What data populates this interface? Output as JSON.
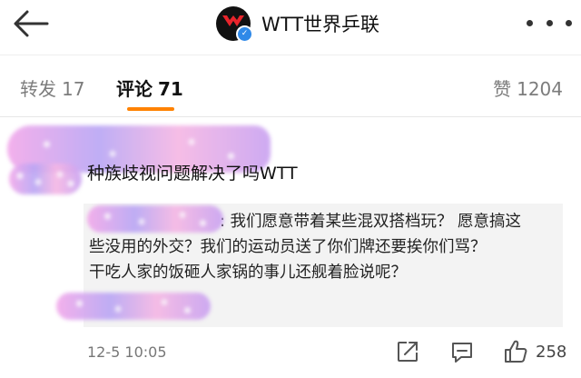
{
  "header": {
    "account_name": "WTT世界乒联"
  },
  "tabs": {
    "repost": {
      "label": "转发",
      "count": "17"
    },
    "comments": {
      "label": "评论",
      "count": "71"
    },
    "likes": {
      "label": "赞",
      "count": "1204"
    }
  },
  "comment": {
    "text": "种族歧视问题解决了吗WTT",
    "reply_lines": [
      ": 我们愿意带着某些混双搭档玩？ 愿意搞这",
      "些没用的外交？我们的运动员送了你们牌还要挨你们骂？",
      "干吃人家的饭砸人家锅的事儿还舰着脸说呢？"
    ],
    "timestamp": "12-5 10:05",
    "like_count": "258"
  },
  "colors": {
    "accent": "#ff8200",
    "verified": "#2f89e8"
  },
  "icons": [
    "back-arrow-icon",
    "more-dots-icon",
    "share-icon",
    "reply-icon",
    "thumbs-up-icon",
    "verified-badge-icon"
  ]
}
